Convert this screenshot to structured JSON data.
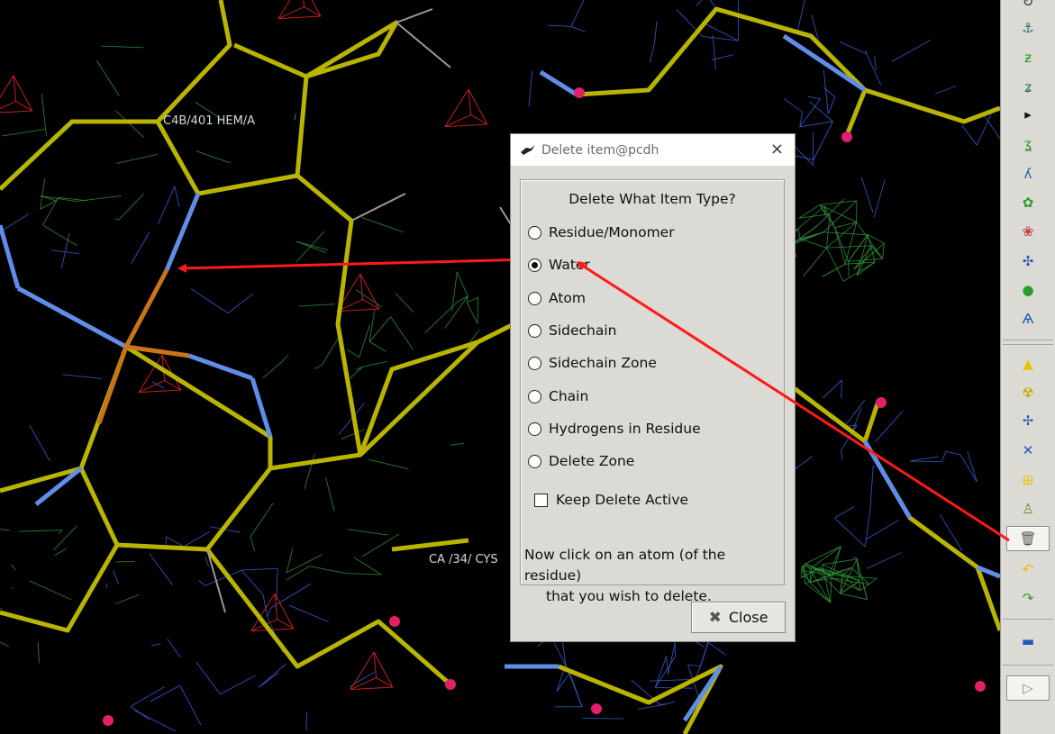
{
  "viewport": {
    "labels": [
      {
        "text": "C4B/401 HEM/A"
      },
      {
        "text": "CA /34/ CYS"
      }
    ]
  },
  "toolbar": {
    "buttons": [
      {
        "name": "rotate-icon",
        "glyph": "↻"
      },
      {
        "name": "anchor-icon",
        "glyph": "⚓"
      },
      {
        "name": "rotamer-icon",
        "glyph": "ƶ"
      },
      {
        "name": "refine-icon",
        "glyph": "ʑ"
      },
      {
        "name": "expand-arrow-icon",
        "glyph": "▸"
      },
      {
        "name": "flip-peptide-icon",
        "glyph": "ʓ"
      },
      {
        "name": "side-chain-icon",
        "glyph": "ʎ"
      },
      {
        "name": "auto-fit-rotamer-icon",
        "glyph": "✿"
      },
      {
        "name": "mutate-icon",
        "glyph": "❀"
      },
      {
        "name": "torsion-icon",
        "glyph": "✣"
      },
      {
        "name": "side-icon",
        "glyph": "●"
      },
      {
        "name": "cis-trans-icon",
        "glyph": "Ѧ"
      },
      {
        "name": "add-terminal-icon",
        "glyph": "▲"
      },
      {
        "name": "radiation-icon",
        "glyph": "☢"
      },
      {
        "name": "add-atom-icon",
        "glyph": "✢"
      },
      {
        "name": "add-alt-conf-icon",
        "glyph": "✕"
      },
      {
        "name": "add-residue-icon",
        "glyph": "⊞"
      },
      {
        "name": "clear-icon",
        "glyph": "♙"
      },
      {
        "name": "delete-trash-icon",
        "glyph": "🗑"
      },
      {
        "name": "undo-icon",
        "glyph": "↶"
      },
      {
        "name": "redo-icon",
        "glyph": "↷"
      },
      {
        "name": "color-bar-icon",
        "glyph": "▬"
      },
      {
        "name": "play-icon",
        "glyph": "▷"
      }
    ],
    "colors": {
      "yellow": "#e8c400",
      "green": "#2a9d2a",
      "blue": "#1e5bb8"
    }
  },
  "dialog": {
    "title": "Delete item@pcdh",
    "close_glyph": "×",
    "frame_title": "Delete What Item Type?",
    "options": [
      {
        "label": "Residue/Monomer",
        "checked": false
      },
      {
        "label": "Water",
        "checked": true
      },
      {
        "label": "Atom",
        "checked": false
      },
      {
        "label": "Sidechain",
        "checked": false
      },
      {
        "label": "Sidechain Zone",
        "checked": false
      },
      {
        "label": "Chain",
        "checked": false
      },
      {
        "label": "Hydrogens in Residue",
        "checked": false
      },
      {
        "label": "Delete Zone",
        "checked": false
      }
    ],
    "keep_active_label": "Keep Delete Active",
    "keep_active_checked": false,
    "hint_line1": "Now click on an atom (of the residue)",
    "hint_line2": "that you wish to delete.",
    "close_button": "Close"
  },
  "colors": {
    "mesh_blue": "#3b5fd6",
    "mesh_green": "#2f8f3a",
    "bond_yellow": "#b8b400",
    "bond_blue": "#5f8de8",
    "bond_orange": "#c87418",
    "annotation_red": "#ff1a1a"
  }
}
